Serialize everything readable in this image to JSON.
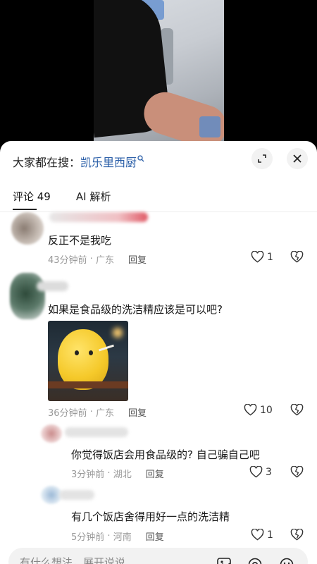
{
  "search": {
    "prefix": "大家都在搜：",
    "term": "凯乐里西厨"
  },
  "tabs": [
    {
      "label": "评论 49"
    },
    {
      "label": "AI 解析"
    }
  ],
  "comments": [
    {
      "text": "反正不是我吃",
      "time": "43分钟前",
      "location": "广东",
      "reply_label": "回复",
      "likes": "1"
    },
    {
      "text": "如果是食品级的洗洁精应该是可以吧?",
      "time": "36分钟前",
      "location": "广东",
      "reply_label": "回复",
      "likes": "10"
    },
    {
      "text": "你觉得饭店会用食品级的? 自己骗自己吧",
      "time": "3分钟前",
      "location": "湖北",
      "reply_label": "回复",
      "likes": "3"
    },
    {
      "text": "有几个饭店舍得用好一点的洗洁精",
      "time": "5分钟前",
      "location": "河南",
      "reply_label": "回复",
      "likes": "1"
    }
  ],
  "input": {
    "placeholder": "有什么想法，展开说说"
  },
  "colors": {
    "search_term": "#2b5fa8",
    "meta": "#999999"
  }
}
